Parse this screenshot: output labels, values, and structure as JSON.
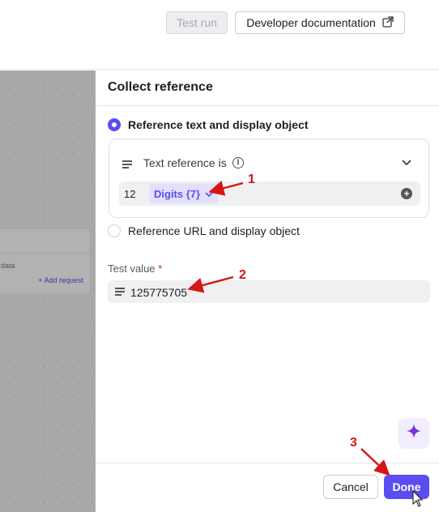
{
  "topbar": {
    "test_run_label": "Test run",
    "docs_label": "Developer documentation"
  },
  "canvas": {
    "data_text": "data",
    "add_request_label": "+ Add request"
  },
  "panel": {
    "title": "Collect reference",
    "option_text": "Reference text and display object",
    "option_url": "Reference URL and display object",
    "selected_option": "option_text",
    "reference_label": "Text reference is",
    "reference_prefix": "12",
    "reference_chip": "Digits {7}",
    "test_value_label": "Test value",
    "required_marker": "*",
    "test_value": "125775705",
    "cancel_label": "Cancel",
    "done_label": "Done"
  },
  "annotations": {
    "marker_1": "1",
    "marker_2": "2",
    "marker_3": "3"
  },
  "colors": {
    "accent": "#5b4ef0",
    "annotation": "#d41616",
    "canvas": "#a9a9a9"
  },
  "icons": [
    "external-link-icon",
    "text-lines-icon",
    "info-icon",
    "chevron-down-icon",
    "plus-circle-icon",
    "sparkle-icon",
    "cursor-icon"
  ]
}
